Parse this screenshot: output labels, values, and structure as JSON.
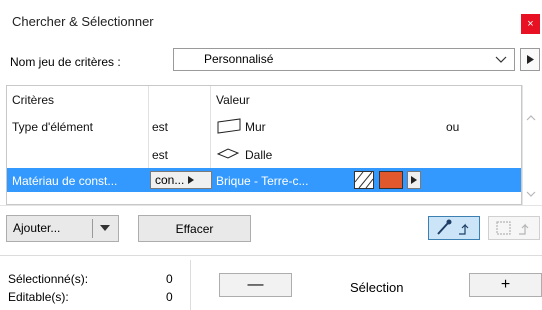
{
  "window": {
    "title": "Chercher & Sélectionner",
    "close_glyph": "×"
  },
  "criteria_set": {
    "label": "Nom jeu de critères :",
    "value": "Personnalisé"
  },
  "table": {
    "headers": {
      "criteria": "Critères",
      "value": "Valeur"
    },
    "rows": [
      {
        "criterion": "Type d'élément",
        "operator": "est",
        "icon": "wall-icon",
        "value": "Mur",
        "logic": "ou",
        "selected": false
      },
      {
        "criterion": "",
        "operator": "est",
        "icon": "slab-icon",
        "value": "Dalle",
        "logic": "",
        "selected": false
      },
      {
        "criterion": "Matériau de const...",
        "operator": "con...",
        "icon": "",
        "value": "Brique - Terre-c...",
        "logic": "",
        "selected": true
      }
    ],
    "material_color": "#e0582c"
  },
  "actions": {
    "add_label": "Ajouter...",
    "clear_label": "Effacer"
  },
  "status": {
    "selected_label": "Sélectionné(s):",
    "selected_count": "0",
    "editable_label": "Editable(s):",
    "editable_count": "0"
  },
  "selection": {
    "label": "Sélection",
    "minus": "—",
    "plus": "+"
  },
  "colors": {
    "accent": "#3399ff",
    "close": "#e81123"
  }
}
